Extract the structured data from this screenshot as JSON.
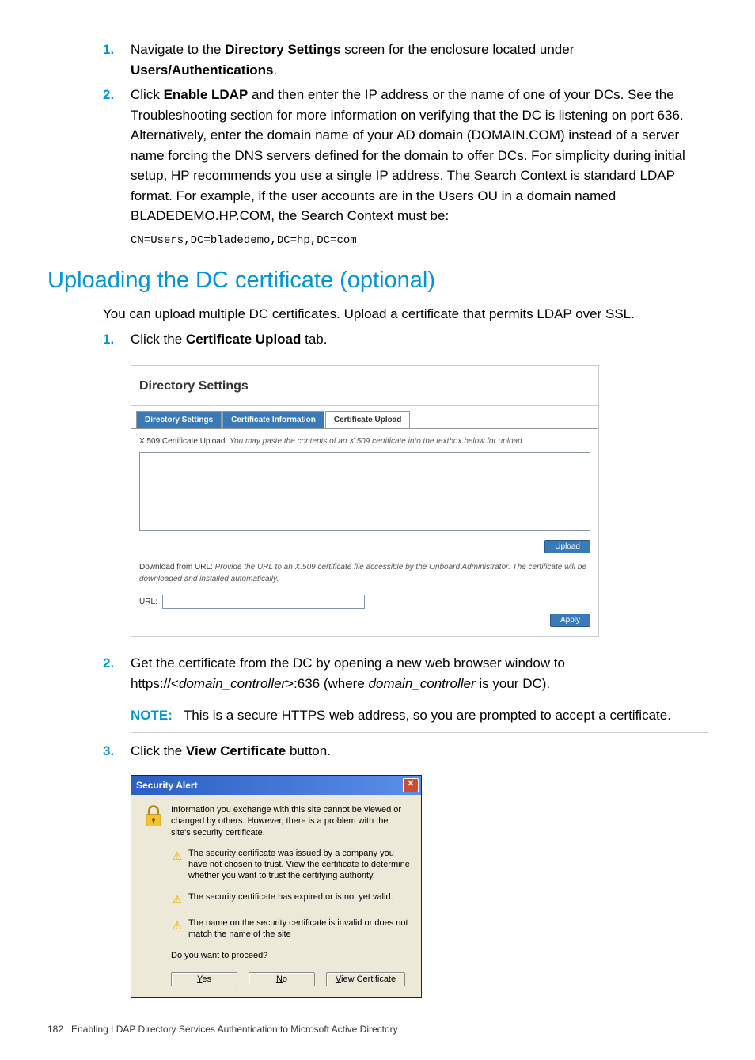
{
  "step1": {
    "num": "1.",
    "pre": "Navigate to the ",
    "b1": "Directory Settings",
    "mid": " screen for the enclosure located under ",
    "b2": "Users/Authentications",
    "post": "."
  },
  "step2": {
    "num": "2.",
    "pre": "Click ",
    "b1": "Enable LDAP",
    "rest": " and then enter the IP address or the name of one of your DCs. See the Troubleshooting section for more information on verifying that the DC is listening on port 636. Alternatively, enter the domain name of your AD domain (DOMAIN.COM) instead of a server name forcing the DNS servers defined for the domain to offer DCs. For simplicity during initial setup, HP recommends you use a single IP address. The Search Context is standard LDAP format. For example, if the user accounts are in the Users OU in a domain named BLADEDEMO.HP.COM, the Search Context must be:"
  },
  "code1": "CN=Users,DC=bladedemo,DC=hp,DC=com",
  "heading": "Uploading the DC certificate (optional)",
  "intro": "You can upload multiple DC certificates. Upload a certificate that permits LDAP over SSL.",
  "ustep1": {
    "num": "1.",
    "pre": "Click the ",
    "b1": "Certificate Upload",
    "post": " tab."
  },
  "ds": {
    "title": "Directory Settings",
    "tab1": "Directory Settings",
    "tab2": "Certificate Information",
    "tab3": "Certificate Upload",
    "l1a": "X.509 Certificate Upload: ",
    "l1b": "You may paste the contents of an X.509 certificate into the textbox below for upload.",
    "uploadBtn": "Upload",
    "l2a": "Download from URL: ",
    "l2b": "Provide the URL to an X.509 certificate file accessible by the Onboard Administrator. The certificate will be downloaded and installed automatically.",
    "urlLabel": "URL:",
    "applyBtn": "Apply"
  },
  "ustep2": {
    "num": "2.",
    "pre": "Get the certificate from the DC by opening a new web browser window to https://<",
    "i1": "domain_controller",
    "mid": ">:636 (where ",
    "i2": "domain_controller",
    "post": " is your DC)."
  },
  "note": {
    "label": "NOTE:",
    "text": "This is a secure HTTPS web address, so you are prompted to accept a certificate."
  },
  "ustep3": {
    "num": "3.",
    "pre": "Click the ",
    "b1": "View Certificate",
    "post": " button."
  },
  "sa": {
    "title": "Security Alert",
    "main": "Information you exchange with this site cannot be viewed or changed by others. However, there is a problem with the site's security certificate.",
    "w1": "The security certificate was issued by a company you have not chosen to trust. View the certificate to determine whether you want to trust the certifying authority.",
    "w2": "The security certificate has expired or is not yet valid.",
    "w3": "The name on the security certificate is invalid or does not match the name of the site",
    "q": "Do you want to proceed?",
    "yes": "es",
    "no": "o",
    "view": "iew Certificate"
  },
  "footer": {
    "page": "182",
    "text": "Enabling LDAP Directory Services Authentication to Microsoft Active Directory"
  }
}
